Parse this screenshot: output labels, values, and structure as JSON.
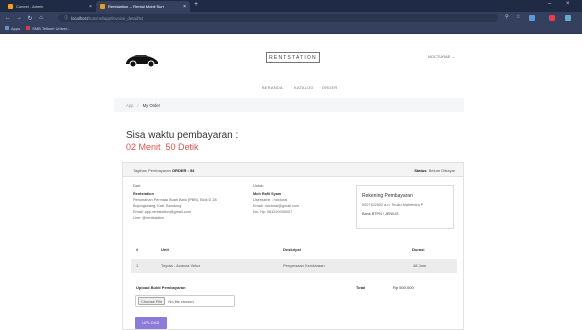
{
  "browser": {
    "tabs": [
      {
        "title": "Cuneel - Admin",
        "active": false,
        "favicon_color": "#f0a020"
      },
      {
        "title": "Rentstation -- Rental Mobil Surr",
        "active": true,
        "favicon_color": "#e0a030"
      }
    ],
    "url_host": "localhost",
    "url_path": "/rummel/app/invoice_detail/54",
    "bookmarks": [
      "Apps",
      "SMB Telkom Univer..."
    ]
  },
  "site": {
    "brand": "RENTSTATION",
    "user": "NOCTURAE",
    "menu": [
      "BERANDA",
      "KATALOG",
      "ORDER"
    ]
  },
  "breadcrumb": {
    "home": "App",
    "separator": "/",
    "current": "My Order"
  },
  "payment": {
    "title": "Sisa waktu pembayaran :",
    "countdown": "02 Menit  50 Detik"
  },
  "invoice": {
    "header_label": "Tagihan Pembayaran",
    "order_id": "ORDER : 54",
    "status_label": "Status",
    "status_value": "Belum Dibayar",
    "from": {
      "heading": "Dari:",
      "name": "Rentstation",
      "lines": [
        "Perumahan Permata Buah Batu (PBB), Blok D 28",
        "Bojongsoang, Kab. Bandung",
        "Email: app.rentstation@gmail.com",
        "Line: @rentstation"
      ]
    },
    "to": {
      "heading": "Untuk:",
      "name": "Moh Rafli Syam",
      "lines": [
        "Username : noctural",
        "Email: noctural@gmail.com",
        "No. Hp: 081220000007"
      ]
    },
    "bank": {
      "title": "Rekening Pembayaran",
      "account": "0007422502 a.n. Teuku Mahendra P",
      "bank": "Bank BTPN / JENIUS"
    },
    "columns": [
      "#",
      "Unit",
      "Deskripsi",
      "Durasi"
    ],
    "rows": [
      {
        "no": "1",
        "unit": "Toyota - Avanza Veloz",
        "desc": "Penyewaan Kendaraan",
        "duration": "48 Jam"
      }
    ],
    "upload_label": "Upload Bukti Pembayaran",
    "total_label": "Total",
    "total_value": "Rp 500.000",
    "file_button": "Choose File",
    "file_status": "No file chosen",
    "upload_button": "UPLOAD"
  }
}
